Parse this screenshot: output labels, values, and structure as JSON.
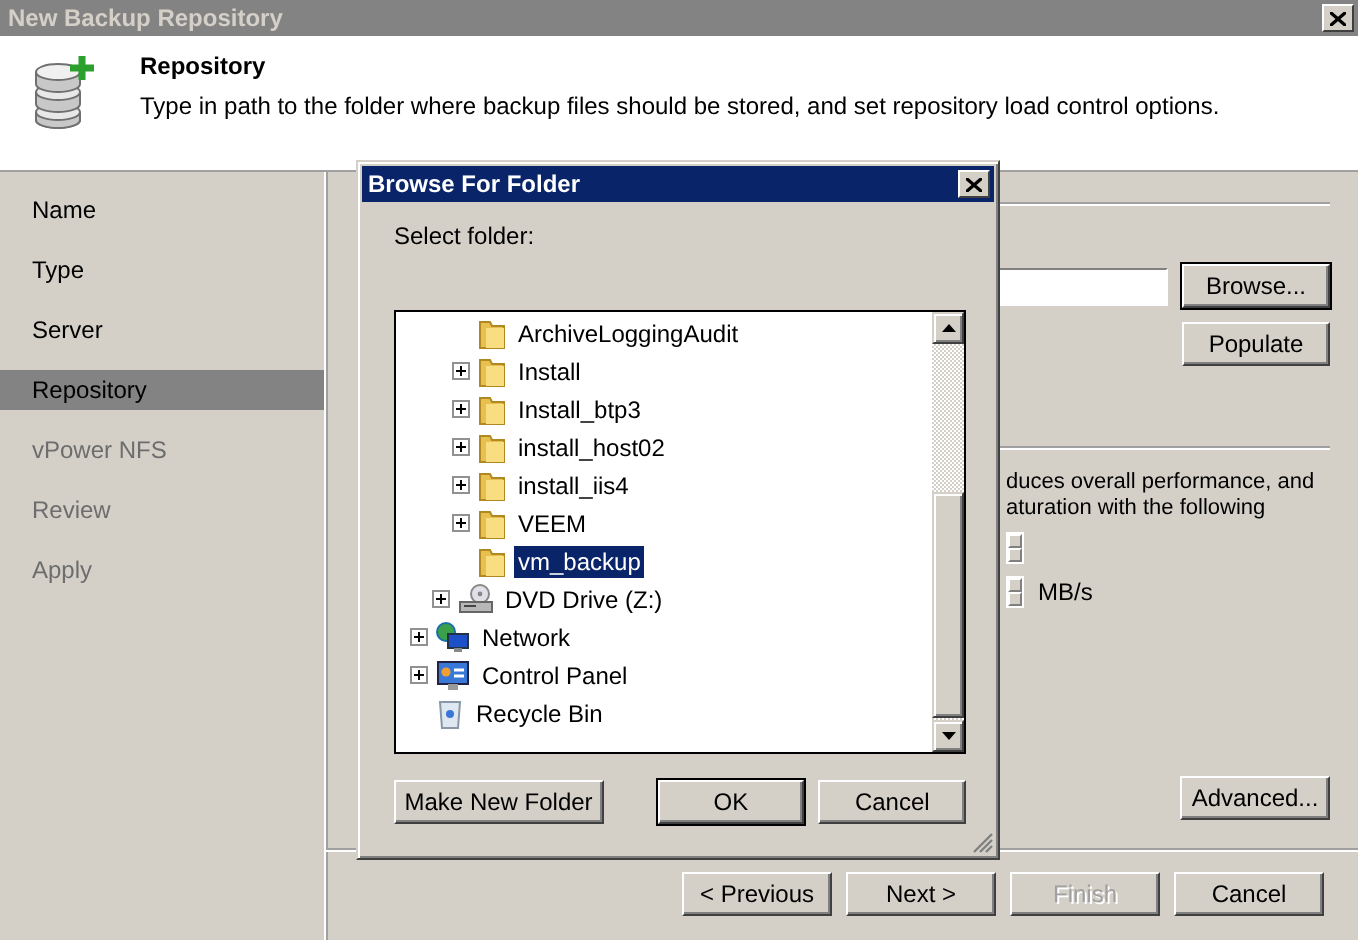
{
  "window": {
    "title": "New Backup Repository"
  },
  "header": {
    "title": "Repository",
    "description": "Type in path to the folder where backup files should be stored, and set repository load control options."
  },
  "steps": [
    {
      "label": "Name",
      "selected": false,
      "disabled": false
    },
    {
      "label": "Type",
      "selected": false,
      "disabled": false
    },
    {
      "label": "Server",
      "selected": false,
      "disabled": false
    },
    {
      "label": "Repository",
      "selected": true,
      "disabled": false
    },
    {
      "label": "vPower NFS",
      "selected": false,
      "disabled": true
    },
    {
      "label": "Review",
      "selected": false,
      "disabled": true
    },
    {
      "label": "Apply",
      "selected": false,
      "disabled": true
    }
  ],
  "repository": {
    "browse_button": "Browse...",
    "populate_button": "Populate",
    "load_control_text": [
      "duces overall performance, and",
      "aturation with the following"
    ],
    "speed_unit": "MB/s",
    "advanced_button": "Advanced..."
  },
  "navigation": [
    {
      "label": "< Previous",
      "disabled": false
    },
    {
      "label": "Next >",
      "disabled": false
    },
    {
      "label": "Finish",
      "disabled": true
    },
    {
      "label": "Cancel",
      "disabled": false
    }
  ],
  "dialog": {
    "title": "Browse For Folder",
    "prompt": "Select folder:",
    "tree": [
      {
        "children": [
          {
            "children": [
              {
                "label": "ArchiveLoggingAudit",
                "kind": "folder",
                "expandable": false,
                "selected": false
              },
              {
                "label": "Install",
                "kind": "folder",
                "expandable": true,
                "selected": false
              },
              {
                "label": "Install_btp3",
                "kind": "folder",
                "expandable": true,
                "selected": false
              },
              {
                "label": "install_host02",
                "kind": "folder",
                "expandable": true,
                "selected": false
              },
              {
                "label": "install_iis4",
                "kind": "folder",
                "expandable": true,
                "selected": false
              },
              {
                "label": "VEEM",
                "kind": "folder",
                "expandable": true,
                "selected": false
              },
              {
                "label": "vm_backup",
                "kind": "folder",
                "expandable": false,
                "selected": true
              }
            ]
          },
          {
            "label": "DVD Drive (Z:)",
            "kind": "dvd",
            "expandable": true,
            "selected": false
          }
        ]
      },
      {
        "label": "Network",
        "kind": "network",
        "expandable": true,
        "selected": false
      },
      {
        "label": "Control Panel",
        "kind": "control-panel",
        "expandable": true,
        "selected": false
      },
      {
        "label": "Recycle Bin",
        "kind": "recycle-bin",
        "expandable": false,
        "selected": false
      }
    ],
    "buttons": [
      {
        "label": "Make New Folder",
        "default": false
      },
      {
        "label": "OK",
        "default": true
      },
      {
        "label": "Cancel",
        "default": false
      }
    ]
  }
}
